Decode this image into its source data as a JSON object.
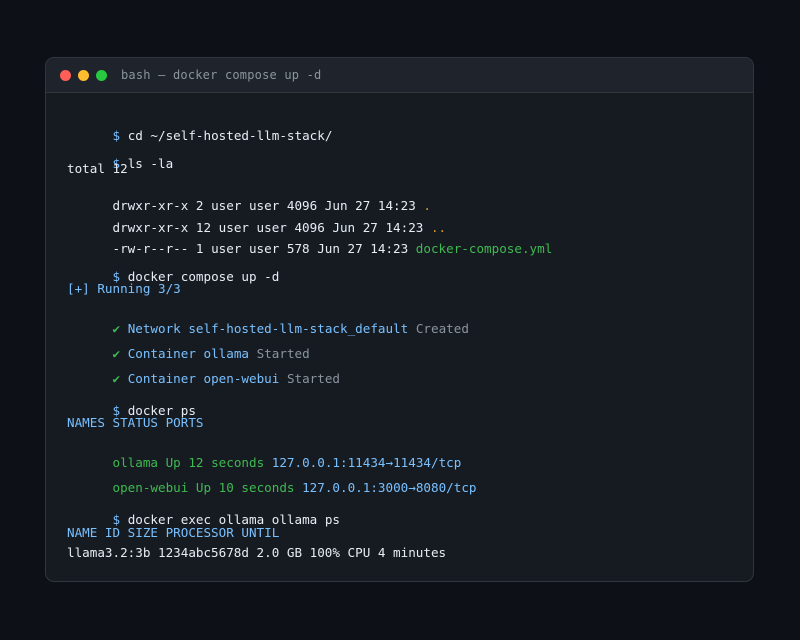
{
  "window": {
    "title": "bash — docker compose up -d"
  },
  "terminal": {
    "prompt": "$",
    "cmd1": "cd ~/self-hosted-llm-stack/",
    "cmd2": "ls -la",
    "ls": {
      "total": "total 12",
      "row1_meta": "drwxr-xr-x 2 user user 4096 Jun 27 14:23",
      "row1_name": ".",
      "row2_meta": "drwxr-xr-x 12 user user 4096 Jun 27 14:23",
      "row2_name": "..",
      "row3_meta": "-rw-r--r-- 1 user user 578 Jun 27 14:23",
      "row3_name": "docker-compose.yml"
    },
    "cmd3": "docker compose up -d",
    "compose": {
      "running": "[+] Running 3/3",
      "check": "✔",
      "item1_name": "Network self-hosted-llm-stack_default",
      "item1_status": "Created",
      "item2_name": "Container ollama",
      "item2_status": "Started",
      "item3_name": "Container open-webui",
      "item3_status": "Started"
    },
    "cmd4": "docker ps",
    "ps": {
      "header": "NAMES STATUS PORTS",
      "row1_name": "ollama",
      "row1_status": "Up 12 seconds",
      "row1_ports": "127.0.0.1:11434→11434/tcp",
      "row2_name": "open-webui",
      "row2_status": "Up 10 seconds",
      "row2_ports": "127.0.0.1:3000→8080/tcp"
    },
    "cmd5": "docker exec ollama ollama ps",
    "ollama_ps": {
      "header": "NAME ID SIZE PROCESSOR UNTIL",
      "row1": "llama3.2:3b 1234abc5678d 2.0 GB 100% CPU 4 minutes"
    }
  },
  "colors": {
    "background": "#0d1117",
    "window": "#161b22",
    "prompt": "#79c0ff",
    "green": "#3fb950",
    "yellow": "#d29922"
  }
}
